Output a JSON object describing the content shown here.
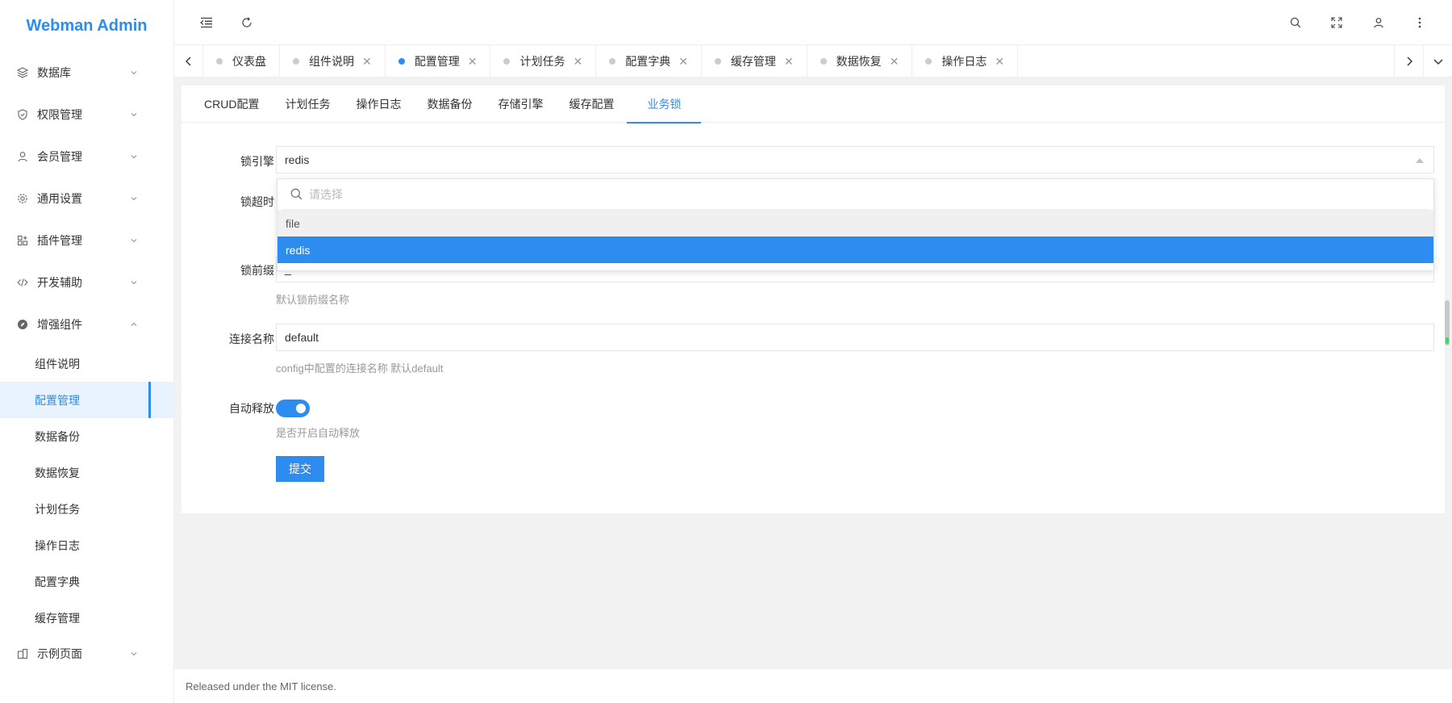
{
  "app": {
    "logo": "Webman Admin",
    "accent": "#2d8cf0"
  },
  "sidebar": {
    "menus": [
      {
        "label": "数据库",
        "icon": "layers-icon"
      },
      {
        "label": "权限管理",
        "icon": "shield-icon"
      },
      {
        "label": "会员管理",
        "icon": "user-icon"
      },
      {
        "label": "通用设置",
        "icon": "gear-icon"
      },
      {
        "label": "插件管理",
        "icon": "plugin-icon"
      },
      {
        "label": "开发辅助",
        "icon": "code-icon"
      },
      {
        "label": "增强组件",
        "icon": "compass-icon"
      }
    ],
    "subitems": [
      "组件说明",
      "配置管理",
      "数据备份",
      "数据恢复",
      "计划任务",
      "操作日志",
      "配置字典",
      "缓存管理"
    ],
    "active_subitem": "配置管理",
    "bottom_menu": {
      "label": "示例页面",
      "icon": "building-icon"
    }
  },
  "tabs": [
    {
      "label": "仪表盘",
      "closable": false
    },
    {
      "label": "组件说明",
      "closable": true
    },
    {
      "label": "配置管理",
      "closable": true,
      "active": true
    },
    {
      "label": "计划任务",
      "closable": true
    },
    {
      "label": "配置字典",
      "closable": true
    },
    {
      "label": "缓存管理",
      "closable": true
    },
    {
      "label": "数据恢复",
      "closable": true
    },
    {
      "label": "操作日志",
      "closable": true
    }
  ],
  "content_tabs": [
    "CRUD配置",
    "计划任务",
    "操作日志",
    "数据备份",
    "存储引擎",
    "缓存配置",
    "业务锁"
  ],
  "active_content_tab": "业务锁",
  "form": {
    "engine_label": "锁引擎",
    "engine_value": "redis",
    "timeout_label": "锁超时",
    "prefix_label": "锁前缀",
    "prefix_value": "_",
    "prefix_hint": "默认锁前缀名称",
    "conn_label": "连接名称",
    "conn_value": "default",
    "conn_hint": "config中配置的连接名称 默认default",
    "auto_label": "自动释放",
    "auto_on": true,
    "auto_hint": "是否开启自动释放",
    "submit_label": "提交"
  },
  "dropdown": {
    "search_placeholder": "请选择",
    "options": [
      "file",
      "redis"
    ],
    "selected": "redis"
  },
  "footer": {
    "text": "Released under the MIT license."
  }
}
